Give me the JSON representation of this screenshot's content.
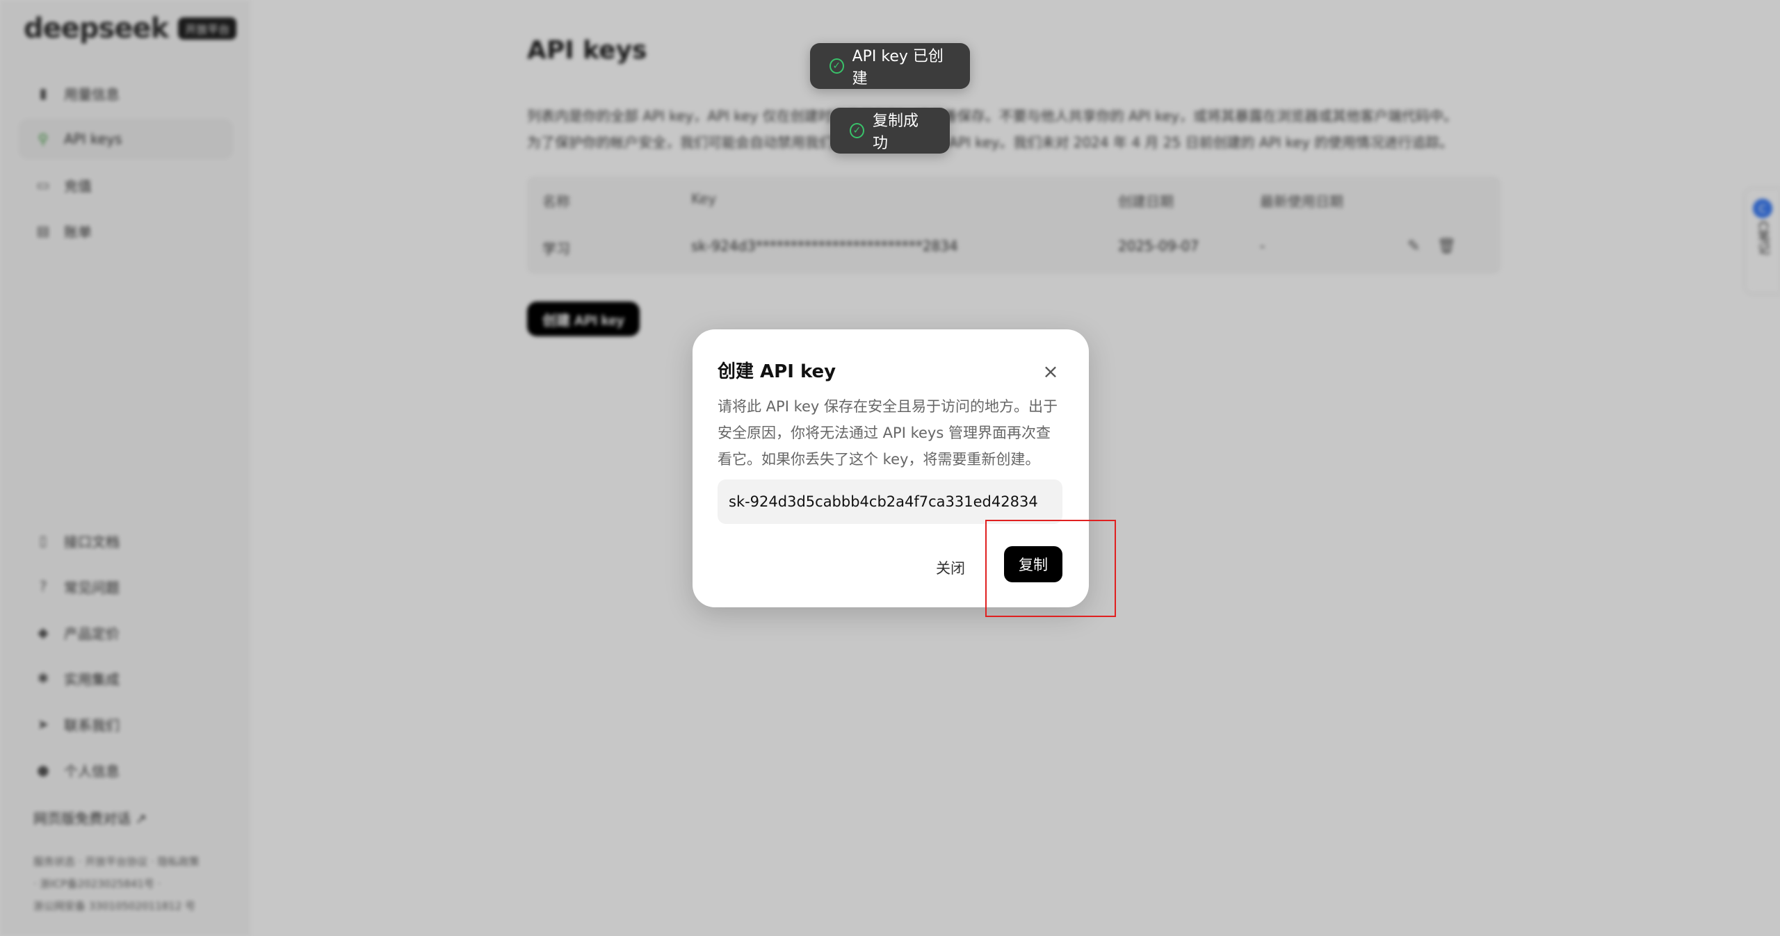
{
  "sidebar": {
    "logo": "deepseek",
    "badge": "开放平台",
    "items": [
      {
        "label": "用量信息",
        "icon": "bar-chart-icon"
      },
      {
        "label": "API keys",
        "icon": "search-icon"
      },
      {
        "label": "充值",
        "icon": "card-icon"
      },
      {
        "label": "账单",
        "icon": "bill-icon"
      }
    ],
    "bottom_items": [
      {
        "label": "接口文档",
        "icon": "doc-icon"
      },
      {
        "label": "常见问题",
        "icon": "question-icon"
      },
      {
        "label": "产品定价",
        "icon": "tag-icon"
      },
      {
        "label": "实用集成",
        "icon": "integration-icon"
      },
      {
        "label": "联系我们",
        "icon": "send-icon"
      },
      {
        "label": "个人信息",
        "icon": "user-icon"
      }
    ],
    "web_chat_link": "网页版免费对话 ↗",
    "footer_line1": "服务状态 · 开放平台协议 · 隐私政策",
    "footer_line2": "· 浙ICP备2023025841号 ·",
    "footer_line3": "浙公网安备 33010502011812 号"
  },
  "main": {
    "title": "API keys",
    "desc_line1": "列表内是你的全部 API key，API key 仅在创建时可见可复制，请妥善保存。不要与他人共享你的 API key，或将其暴露在浏览器或其他客户端代码中。",
    "desc_line2": "为了保护你的帐户安全，我们可能会自动禁用我们发现已公开泄露的 API key。我们未对 2024 年 4 月 25 日前创建的 API key 的使用情况进行追踪。",
    "table": {
      "headers": [
        "名称",
        "Key",
        "创建日期",
        "最新使用日期"
      ],
      "row": {
        "name": "学习",
        "key": "sk-924d3************************2834",
        "created": "2025-09-07",
        "last_used": "-"
      }
    },
    "create_button": "创建 API key"
  },
  "float_tab": {
    "label": "C笔记"
  },
  "toasts": {
    "created": "API key 已创建",
    "copied": "复制成功"
  },
  "modal": {
    "title": "创建 API key",
    "line1": "请将此 API key 保存在安全且易于访问的地方。出于",
    "line2": "安全原因，你将无法通过 API keys 管理界面再次查",
    "line3": "看它。如果你丢失了这个 key，将需要重新创建。",
    "key_value": "sk-924d3d5cabbb4cb2a4f7ca331ed42834",
    "close_label": "关闭",
    "copy_label": "复制"
  }
}
